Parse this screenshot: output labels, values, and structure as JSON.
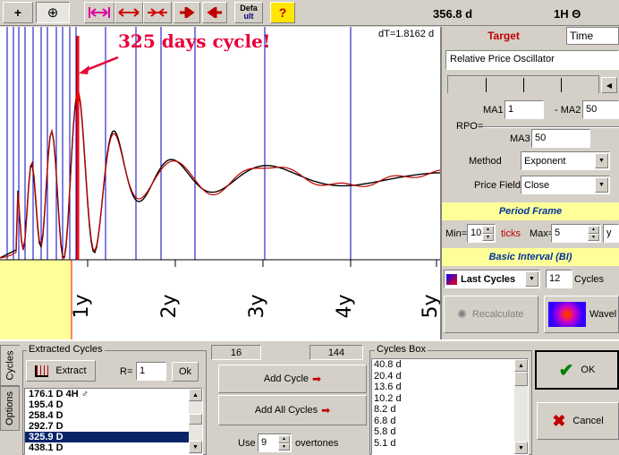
{
  "toolbar": {
    "plus": "+",
    "zoom": "⊕",
    "defa": "Defa",
    "ult": "ult",
    "help": "?",
    "center_value": "356.8 d",
    "right_value": "1H Θ"
  },
  "chart": {
    "annotation": "325 days cycle!",
    "dt": "dT=1.8162 d",
    "x_ticks": [
      "1y",
      "2y",
      "3y",
      "4y",
      "5y"
    ]
  },
  "right_panel": {
    "tabs": [
      "Target",
      "Time"
    ],
    "indicator": "Relative Price Oscillator",
    "ma1_label": "MA1",
    "ma1_value": "1",
    "ma2_label": "- MA2",
    "ma2_value": "50",
    "rpo_label": "RPO=",
    "ma3_label": "MA3",
    "ma3_value": "50",
    "method_label": "Method",
    "method_value": "Exponent",
    "price_field_label": "Price Field",
    "price_field_value": "Close",
    "period_frame_title": "Period Frame",
    "min_label": "Min=",
    "min_value": "10",
    "ticks_label": "ticks",
    "max_label": "Max=",
    "max_value": "5",
    "max_unit": "y",
    "basic_interval_title": "Basic Interval (BI)",
    "last_cycles_label": "Last Cycles",
    "last_cycles_value": "12",
    "cycles_label": "Cycles",
    "recalculate_label": "Recalculate",
    "wavelet_label": "Wavel"
  },
  "bottom": {
    "side_tabs": [
      "Cycles",
      "Options"
    ],
    "extracted_title": "Extracted Cycles",
    "extract_label": "Extract",
    "r_label": "R=",
    "r_value": "1",
    "ok_small": "Ok",
    "extracted_list": [
      "176.1 D  4H ♂",
      "195.4 D",
      "258.4 D",
      "292.7 D",
      "325.9 D",
      "438.1 D"
    ],
    "count_a": "16",
    "count_b": "144",
    "add_cycle_label": "Add Cycle",
    "add_all_label": "Add All Cycles",
    "use_label": "Use",
    "use_value": "9",
    "overtones_label": "overtones",
    "cycles_box_title": "Cycles Box",
    "cycles_box_list": [
      "40.8 d",
      "20.4 d",
      "13.6 d",
      "10.2 d",
      "8.2 d",
      "6.8 d",
      "5.8 d",
      "5.1 d"
    ],
    "ok_label": "OK",
    "cancel_label": "Cancel"
  }
}
